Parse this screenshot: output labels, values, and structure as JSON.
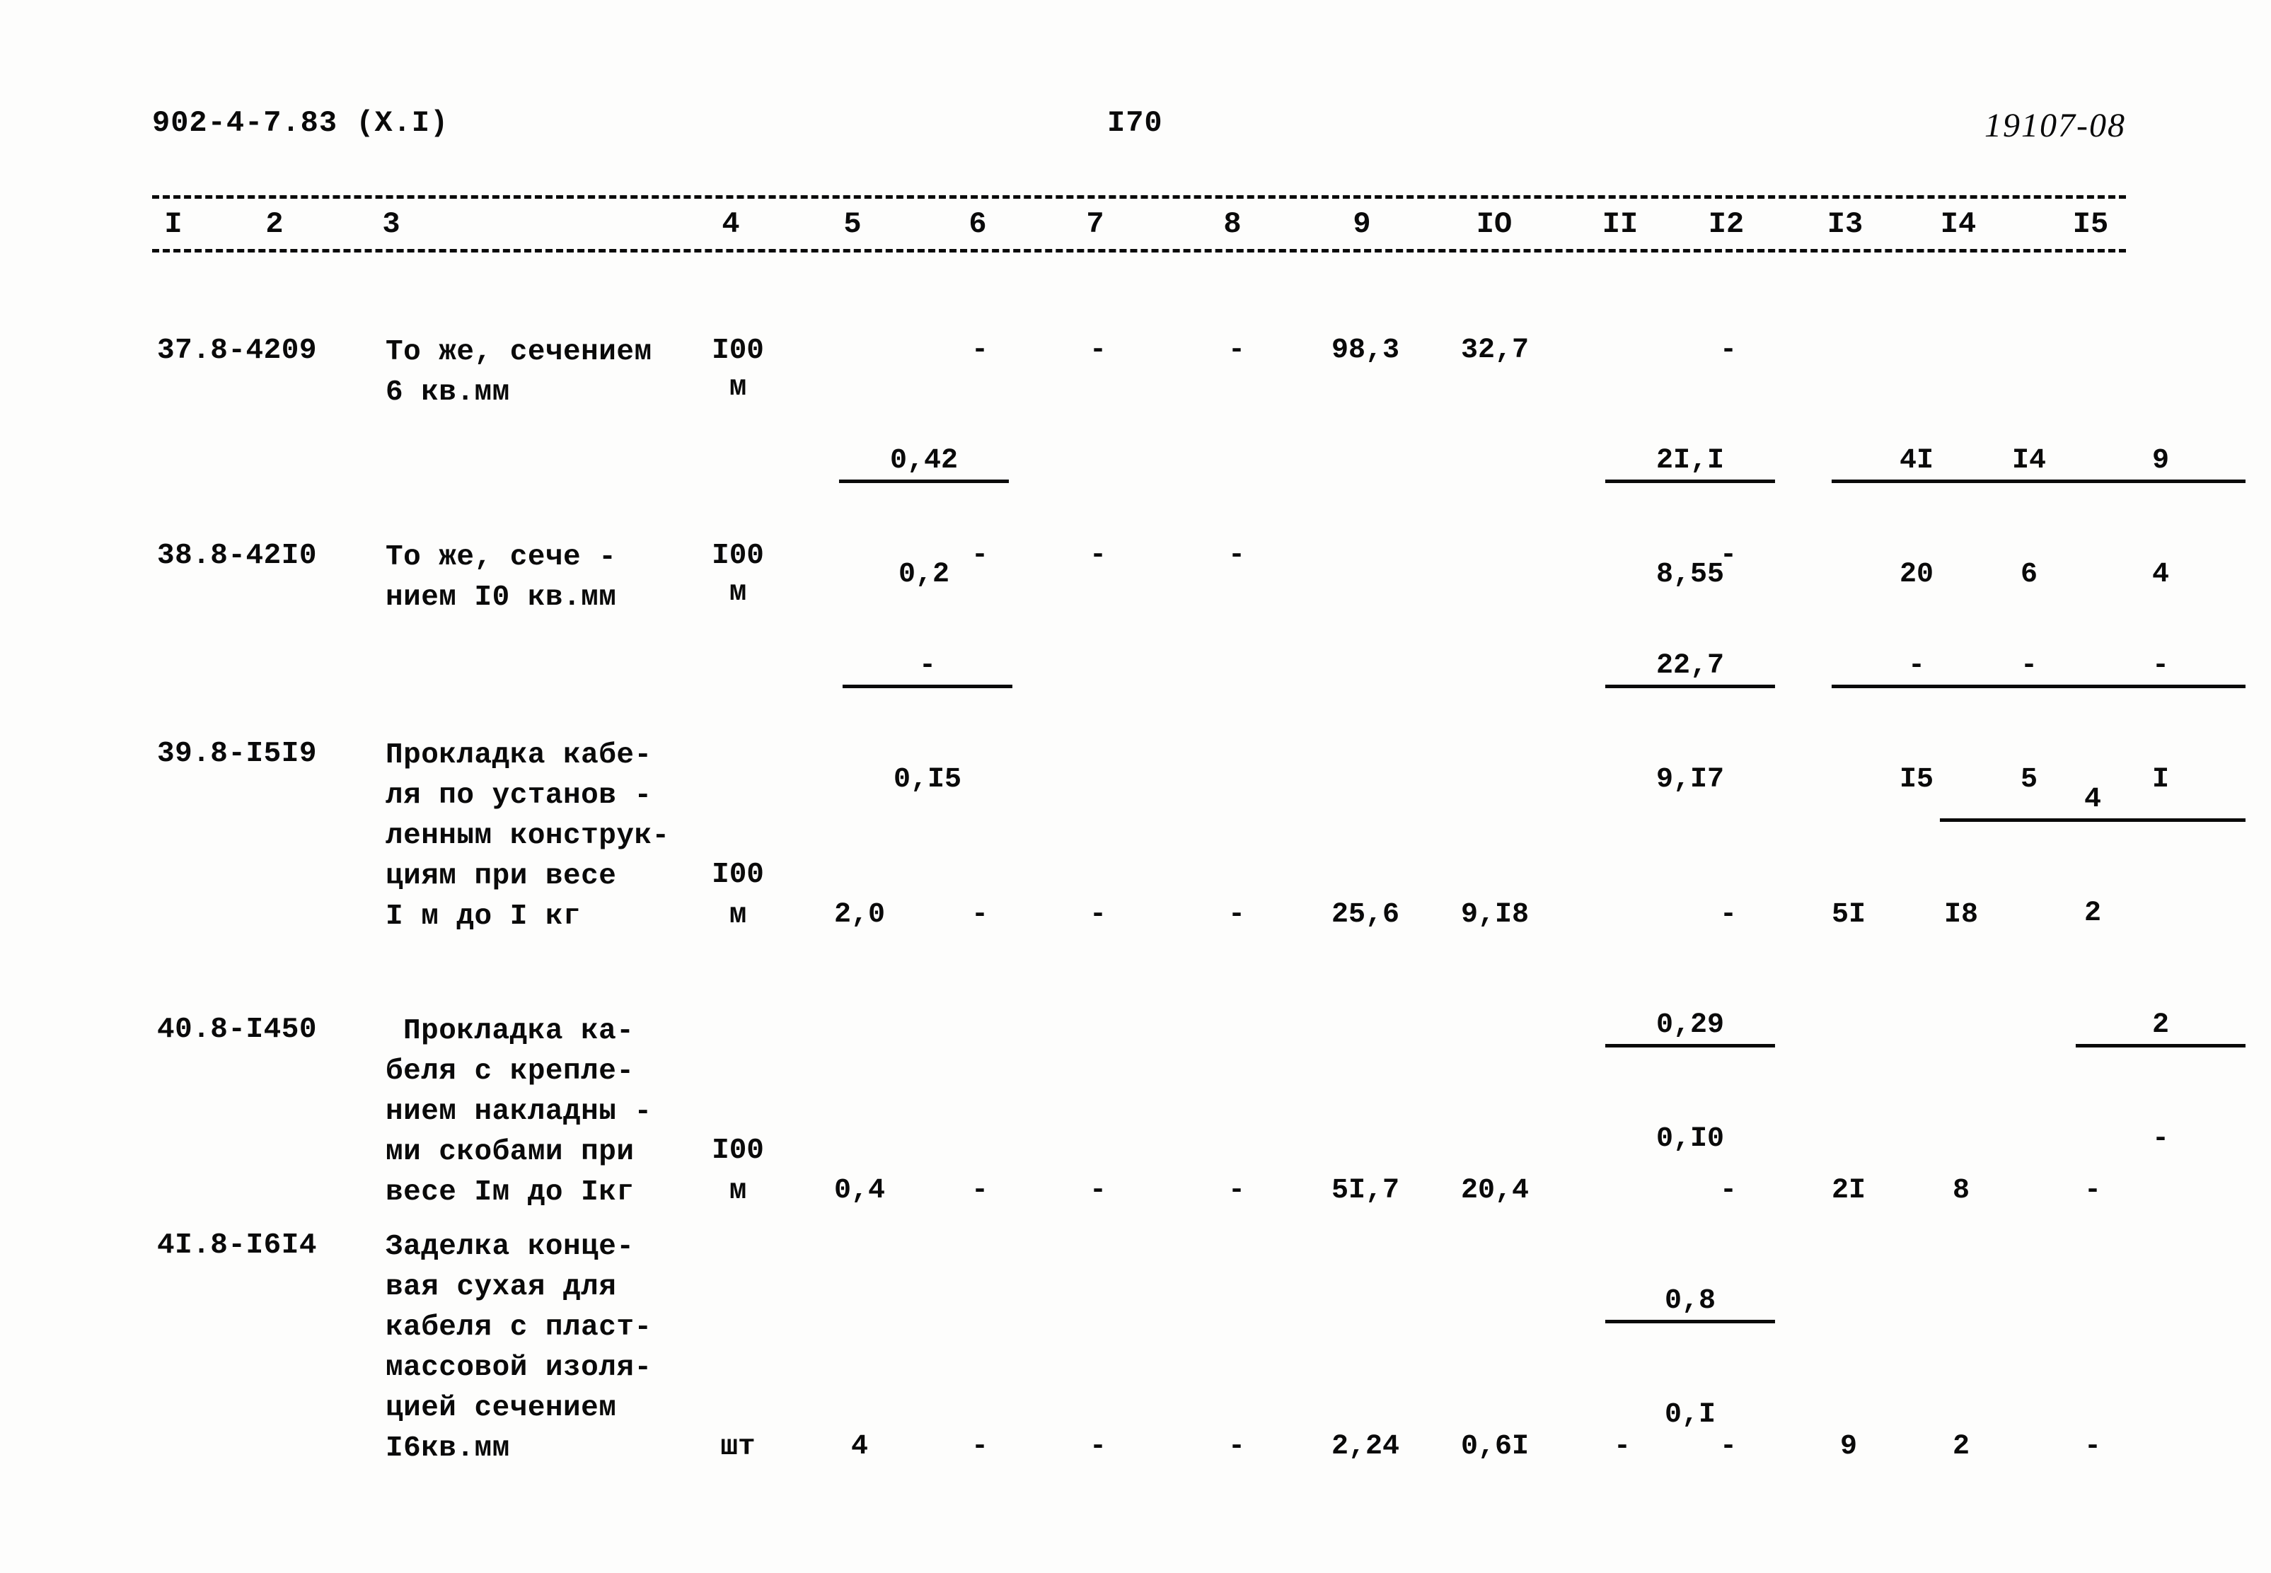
{
  "header": {
    "left": "902-4-7.83 (X.I)",
    "center": "I70",
    "right": "19107-08"
  },
  "table": {
    "column_headers": [
      "I",
      "2",
      "3",
      "4",
      "5",
      "6",
      "7",
      "8",
      "9",
      "IO",
      "II",
      "I2",
      "I3",
      "I4",
      "I5"
    ],
    "rows": [
      {
        "code": "37.8-4209",
        "description": [
          "То же, сечением",
          "6 кв.мм"
        ],
        "unit": [
          "I00",
          "м"
        ],
        "c5_top": "0,42",
        "c5_bot": "0,2",
        "c6": "-",
        "c7": "-",
        "c8": "-",
        "c9": "98,3",
        "c10": "32,7",
        "c11_top": "2I,I",
        "c11_bot": "8,55",
        "c12": "-",
        "c13_top": "4I",
        "c13_bot": "20",
        "c14_top": "I4",
        "c14_bot": "6",
        "c15_top": "9",
        "c15_bot": "4",
        "c15_top2": "4",
        "c15_bot2": "2"
      },
      {
        "code": "38.8-42I0",
        "description": [
          "То же, сече -",
          "нием I0 кв.мм"
        ],
        "unit": [
          "I00",
          "м"
        ],
        "c5_top": "-",
        "c5_bot": "0,I5",
        "c6": "-",
        "c7": "-",
        "c8": "-",
        "c9": "",
        "c10": "",
        "c11_top": "22,7",
        "c11_bot": "9,I7",
        "c12": "-",
        "c13_top": "-",
        "c13_bot": "I5",
        "c14_top": "-",
        "c14_bot": "5",
        "c15_top": "-",
        "c15_bot": "I"
      },
      {
        "code": "39.8-I5I9",
        "description": [
          "Прокладка кабе-",
          "ля по установ -",
          "ленным конструк-",
          "циям при весе",
          "I м до I кг"
        ],
        "unit": [
          "I00",
          "м"
        ],
        "c5": "2,0",
        "c6": "-",
        "c7": "-",
        "c8": "-",
        "c9": "25,6",
        "c10": "9,I8",
        "c11_top": "0,29",
        "c11_bot": "0,I0",
        "c12": "-",
        "c13": "5I",
        "c14": "I8",
        "c15_top": "2",
        "c15_bot": "-"
      },
      {
        "code": "40.8-I450",
        "description": [
          "Прокладка ка-",
          "беля с крепле-",
          "нием накладны -",
          "ми скобами при",
          "весе Iм до Iкг"
        ],
        "unit": [
          "I00",
          "м"
        ],
        "c5": "0,4",
        "c6": "-",
        "c7": "-",
        "c8": "-",
        "c9": "5I,7",
        "c10": "20,4",
        "c11_top": "0,8",
        "c11_bot": "0,I",
        "c12": "-",
        "c13": "2I",
        "c14": "8",
        "c15": "-"
      },
      {
        "code": "4I.8-I6I4",
        "description": [
          "Заделка конце-",
          "вая сухая для",
          "кабеля с пласт-",
          "массовой изоля-",
          "цией сечением",
          "I6кв.мм"
        ],
        "unit": [
          "шт"
        ],
        "c5": "4",
        "c6": "-",
        "c7": "-",
        "c8": "-",
        "c9": "2,24",
        "c10": "0,6I",
        "c11": "-",
        "c12": "-",
        "c13": "9",
        "c14": "2",
        "c15": "-"
      }
    ]
  }
}
